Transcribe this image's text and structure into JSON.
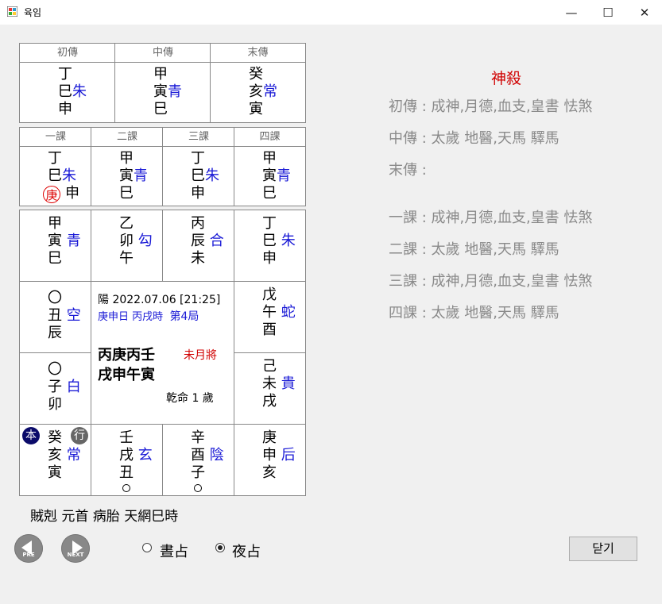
{
  "window": {
    "title": "육임",
    "min": "—",
    "max": "☐",
    "close": "✕"
  },
  "sanchuan": {
    "headers": [
      "初傳",
      "中傳",
      "末傳"
    ],
    "cells": [
      {
        "top": "丁",
        "mid": "巳",
        "gen": "朱",
        "bot": "申"
      },
      {
        "top": "甲",
        "mid": "寅",
        "gen": "青",
        "bot": "巳"
      },
      {
        "top": "癸",
        "mid": "亥",
        "gen": "常",
        "bot": "寅"
      }
    ]
  },
  "sike": {
    "headers": [
      "一課",
      "二課",
      "三課",
      "四課"
    ],
    "cells": [
      {
        "top": "丁",
        "mid": "巳",
        "gen": "朱",
        "ring": "庚",
        "bot": "申"
      },
      {
        "top": "甲",
        "mid": "寅",
        "gen": "青",
        "bot": "巳"
      },
      {
        "top": "丁",
        "mid": "巳",
        "gen": "朱",
        "bot": "申"
      },
      {
        "top": "甲",
        "mid": "寅",
        "gen": "青",
        "bot": "巳"
      }
    ]
  },
  "board": {
    "r1": [
      {
        "top": "甲",
        "mid": "寅",
        "gen": "青",
        "bot": "巳"
      },
      {
        "top": "乙",
        "mid": "卯",
        "gen": "勾",
        "bot": "午"
      },
      {
        "top": "丙",
        "mid": "辰",
        "gen": "合",
        "bot": "未"
      },
      {
        "top": "丁",
        "mid": "巳",
        "gen": "朱",
        "bot": "申"
      }
    ],
    "l2": {
      "top": "〇",
      "mid": "丑",
      "gen": "空",
      "bot": "辰"
    },
    "l3": {
      "top": "〇",
      "mid": "子",
      "gen": "白",
      "bot": "卯"
    },
    "rt2": {
      "top": "戊",
      "mid": "午",
      "gen": "蛇",
      "bot": "酉"
    },
    "rt3": {
      "top": "己",
      "mid": "未",
      "gen": "貴",
      "bot": "戌"
    },
    "r4": [
      {
        "top": "癸",
        "mid": "亥",
        "gen": "常",
        "bot": "寅"
      },
      {
        "top": "壬",
        "mid": "戌",
        "gen": "玄",
        "bot": "丑"
      },
      {
        "top": "辛",
        "mid": "酉",
        "gen": "陰",
        "bot": "子"
      },
      {
        "top": "庚",
        "mid": "申",
        "gen": "后",
        "bot": "亥"
      }
    ],
    "badge_left": "本",
    "badge_right": "行",
    "center": {
      "line1": "陽 2022.07.06 [21:25]",
      "day": "庚申日",
      "hour": "丙戌時",
      "ju": "第4局",
      "pillars_top": "丙庚丙壬",
      "pillars_bottom": "戌申午寅",
      "month_general": "未月將",
      "age": "乾命 1 歲"
    }
  },
  "footer_text": "賊剋 元首 病胎 天網巳時",
  "nav": {
    "prev": "PRE",
    "next": "NEXT"
  },
  "options": {
    "day": "晝占",
    "night": "夜占",
    "selected": "night"
  },
  "close_button": "닫기",
  "shensha": {
    "title": "神殺",
    "lines": [
      "初傳 :  成神,月德,血支,皇書 怯煞",
      "中傳 : 太歲 地醫,天馬 驛馬",
      "末傳 :",
      "一課 :  成神,月德,血支,皇書 怯煞",
      "二課 : 太歲 地醫,天馬 驛馬",
      "三課 :  成神,月德,血支,皇書 怯煞",
      "四課 : 太歲 地醫,天馬 驛馬"
    ]
  },
  "colors": {
    "god": "#1a1ad6",
    "accent_red": "#d00000",
    "muted": "#8a8a8a"
  }
}
